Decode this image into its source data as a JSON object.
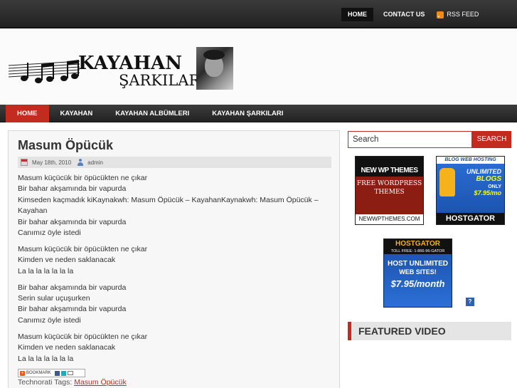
{
  "topnav": {
    "home": "HOME",
    "contact": "CONTACT US",
    "rss": "RSS FEED"
  },
  "logo": {
    "line1": "KAYAHAN",
    "line2": "ŞARKILARI"
  },
  "mainnav": {
    "items": [
      "HOME",
      "KAYAHAN",
      "KAYAHAN ALBÜMLERI",
      "KAYAHAN ŞARKILARI"
    ]
  },
  "post": {
    "title": "Masum Öpücük",
    "date": "May 18th, 2010",
    "author": "admin",
    "stanzas": [
      [
        "Masum küçücük bir öpücükten ne çıkar",
        "Bir bahar akşamında bir vapurda",
        "Kimseden kaçmadık kiKaynakwh: Masum Öpücük – KayahanKaynakwh: Masum Öpücük – Kayahan",
        "Bir bahar akşamında bir vapurda",
        "Canımız öyle istedi"
      ],
      [
        "Masum küçücük bir öpücükten ne çıkar",
        "Kimden ve neden saklanacak",
        "La la la la la la la"
      ],
      [
        "Bir bahar akşamında bir vapurda",
        "Serin sular uçuşurken",
        "Bir bahar akşamında bir vapurda",
        "Canımız öyle istedi"
      ],
      [
        "Masum küçücük bir öpücükten ne çıkar",
        "Kimden ve neden saklanacak",
        "La la la la la la la"
      ]
    ],
    "bookmark_label": "BOOKMARK",
    "technorati_prefix": "Technorati Tags:",
    "technorati_tag": "Masum Öpücük"
  },
  "sidebar": {
    "search_placeholder": "Search",
    "search_button": "SEARCH",
    "ads": {
      "newwp": {
        "header": "NEW WP THEMES",
        "body": "FREE WORDPRESS THEMES",
        "footer": "NEWWPTHEMES.COM"
      },
      "hostgator1": {
        "header": "BLOG WEB HOSTING",
        "line1": "UNLIMITED",
        "line2": "BLOGS",
        "line3": "ONLY",
        "price": "$7.95/mo",
        "footer": "HOSTGATOR"
      },
      "hostgator2": {
        "header": "HOSTGATOR",
        "tollfree": "TOLL FREE: 1-866-96-GATOR",
        "line1": "HOST UNLIMITED",
        "line2": "WEB SITES!",
        "price": "$7.95/month"
      }
    },
    "help_icon": "?",
    "featured_video": "FEATURED VIDEO"
  },
  "colors": {
    "accent": "#c32b1f",
    "nav_bg": "#2a2a2a"
  }
}
